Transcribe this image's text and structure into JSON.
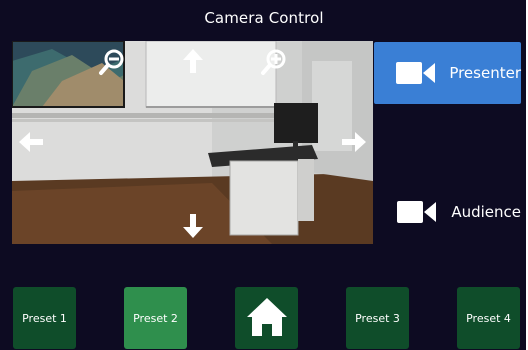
{
  "header": {
    "title": "Camera Control"
  },
  "camera": {
    "controls": [
      "zoom-out-icon",
      "zoom-in-icon",
      "arrow-up-icon",
      "arrow-down-icon",
      "arrow-left-icon",
      "arrow-right-icon"
    ]
  },
  "sources": [
    {
      "label": "Presenter",
      "icon": "video-camera-icon",
      "active": true
    },
    {
      "label": "Audience",
      "icon": "video-camera-icon",
      "active": false
    }
  ],
  "presets": [
    {
      "label": "Preset 1",
      "selected": false
    },
    {
      "label": "Preset 2",
      "selected": true
    },
    {
      "label": "",
      "icon": "home-icon"
    },
    {
      "label": "Preset 3",
      "selected": false
    },
    {
      "label": "Preset 4",
      "selected": false
    }
  ],
  "colors": {
    "background": "#0d0b22",
    "active_source": "#3a7fd5",
    "preset": "#0f4d2a",
    "preset_selected": "#2f8f4d"
  }
}
